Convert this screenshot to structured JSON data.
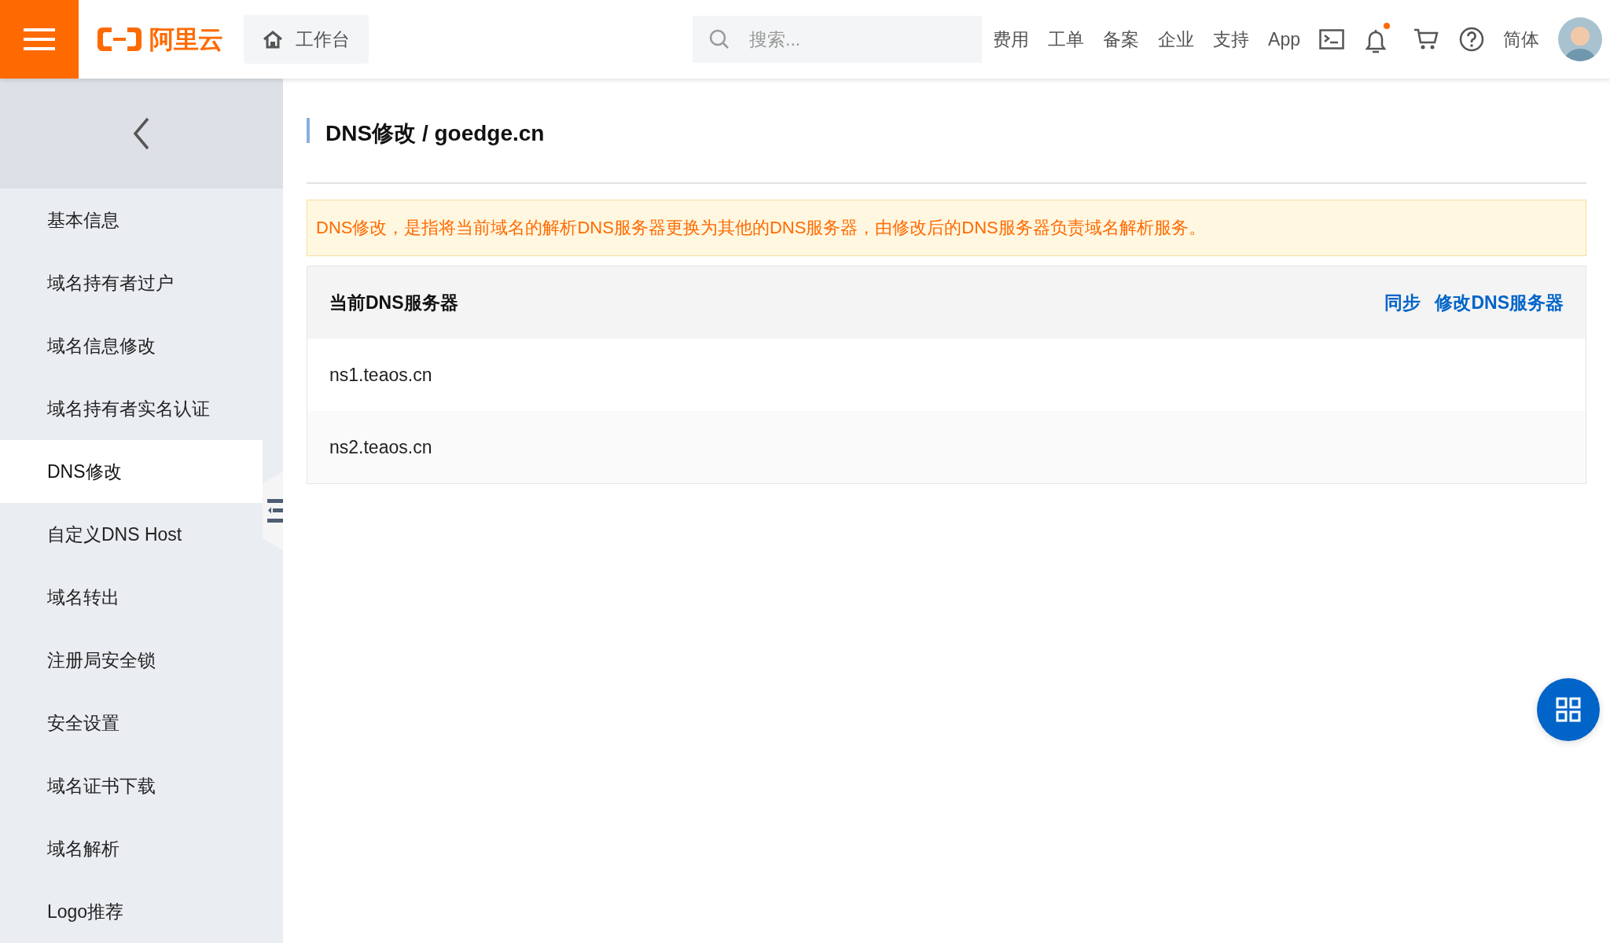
{
  "header": {
    "logo_text": "阿里云",
    "workbench": "工作台",
    "search": {
      "placeholder": "搜索..."
    },
    "nav": [
      "费用",
      "工单",
      "备案",
      "企业",
      "支持",
      "App"
    ],
    "notification_dot": true,
    "language": "简体"
  },
  "sidebar": {
    "items": [
      {
        "label": "基本信息",
        "selected": false
      },
      {
        "label": "域名持有者过户",
        "selected": false
      },
      {
        "label": "域名信息修改",
        "selected": false
      },
      {
        "label": "域名持有者实名认证",
        "selected": false
      },
      {
        "label": "DNS修改",
        "selected": true
      },
      {
        "label": "自定义DNS Host",
        "selected": false
      },
      {
        "label": "域名转出",
        "selected": false
      },
      {
        "label": "注册局安全锁",
        "selected": false
      },
      {
        "label": "安全设置",
        "selected": false
      },
      {
        "label": "域名证书下载",
        "selected": false
      },
      {
        "label": "域名解析",
        "selected": false
      },
      {
        "label": "Logo推荐",
        "selected": false
      }
    ]
  },
  "page": {
    "title": "DNS修改 / goedge.cn",
    "notice": "DNS修改，是指将当前域名的解析DNS服务器更换为其他的DNS服务器，由修改后的DNS服务器负责域名解析服务。",
    "table": {
      "heading": "当前DNS服务器",
      "actions": [
        "同步",
        "修改DNS服务器"
      ],
      "rows": [
        "ns1.teaos.cn",
        "ns2.teaos.cn"
      ]
    }
  }
}
